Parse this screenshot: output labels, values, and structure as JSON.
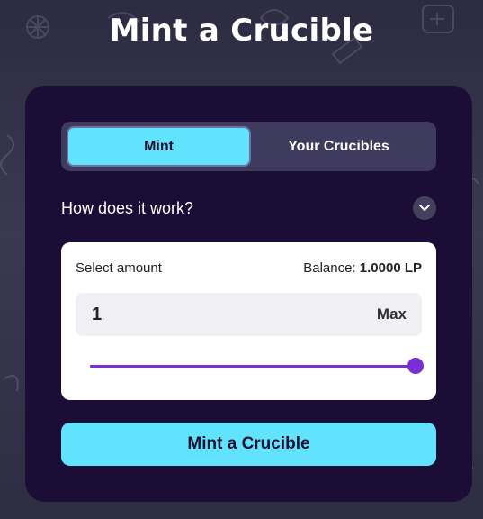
{
  "page": {
    "title": "Mint a Crucible"
  },
  "tabs": [
    {
      "label": "Mint",
      "active": true
    },
    {
      "label": "Your Crucibles",
      "active": false
    }
  ],
  "how_it_works": {
    "label": "How does it work?",
    "icon": "chevron-down-icon"
  },
  "amount": {
    "label": "Select amount",
    "balance_label": "Balance:",
    "balance_value": "1.0000 LP",
    "input_value": "1",
    "max_label": "Max",
    "slider_fraction": 1.0
  },
  "submit": {
    "label": "Mint a Crucible"
  },
  "colors": {
    "accent_cyan": "#61e3fd",
    "card_bg": "#1c0d36",
    "slider_purple": "#7a2ed6",
    "tab_bar_bg": "#3f3b5e"
  }
}
